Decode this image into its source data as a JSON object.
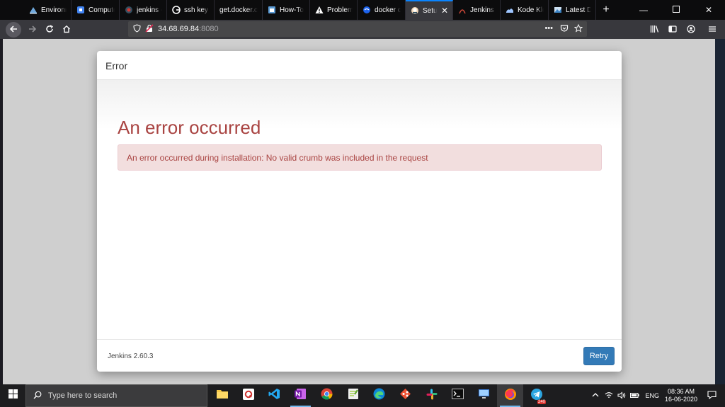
{
  "browser": {
    "tabs": [
      {
        "label": "Environm",
        "icon": "environment-tab-icon"
      },
      {
        "label": "Compute",
        "icon": "compute-tab-icon"
      },
      {
        "label": "jenkins -",
        "icon": "jenkins-tab-icon"
      },
      {
        "label": "ssh key c",
        "icon": "google-tab-icon"
      },
      {
        "label": "get.docker.co",
        "icon": ""
      },
      {
        "label": "How-To",
        "icon": "howto-tab-icon"
      },
      {
        "label": "Problem",
        "icon": "warning-tab-icon"
      },
      {
        "label": "docker c",
        "icon": "docker-tab-icon"
      },
      {
        "label": "Setup",
        "icon": "jenkins-tab-icon"
      },
      {
        "label": "Jenkins 2",
        "icon": "jenkins-tab-icon"
      },
      {
        "label": "Kode Klo",
        "icon": "kodekloud-tab-icon"
      },
      {
        "label": "Latest Do",
        "icon": "latest-tab-icon"
      }
    ],
    "active_tab_index": 8,
    "new_tab_label": "+",
    "url_host": "34.68.69.84",
    "url_port": ":8080",
    "page_actions": "•••"
  },
  "dialog": {
    "title": "Error",
    "heading": "An error occurred",
    "alert_text": "An error occurred during installation: No valid crumb was included in the request",
    "version": "Jenkins 2.60.3",
    "retry_label": "Retry"
  },
  "taskbar": {
    "search_placeholder": "Type here to search",
    "language": "ENG",
    "time": "08:36 AM",
    "date": "16-06-2020",
    "telegram_badge": "240"
  },
  "colors": {
    "error_red": "#a94442",
    "alert_bg": "#f2dede",
    "retry_blue": "#337ab7",
    "tab_accent": "#0a84ff"
  }
}
